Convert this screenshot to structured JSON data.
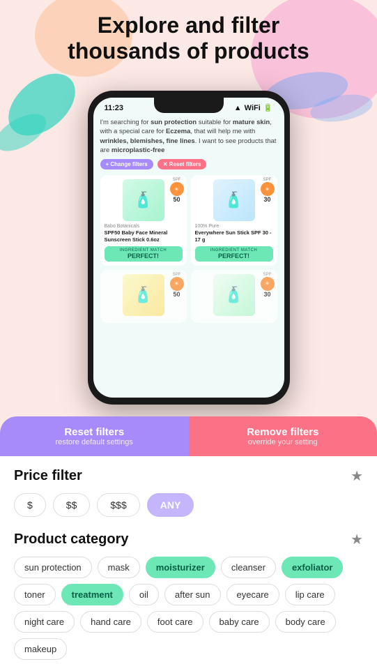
{
  "hero": {
    "title_line1": "Explore and filter",
    "title_line2": "thousands of products"
  },
  "phone": {
    "status_time": "11:23",
    "search_text_html": "I'm searching for <strong>sun protection</strong> suitable for <strong>mature skin</strong>, with a special care for <strong>Eczema</strong>, that will help me with <strong>wrinkles, blemishes, fine lines</strong>. I want to see products that are <strong>microplastic-free</strong>",
    "btn_change_filters": "+ Change filters",
    "btn_reset_filters_top": "✕ Reset filters",
    "products": [
      {
        "brand": "Babo Botanicals",
        "name": "SPF50 Baby Face Mineral Sunscreen Stick 0.6oz",
        "spf_label": "SPF",
        "spf_value": "50",
        "match_label": "INGREDIENT MATCH",
        "match_value": "PERFECT!"
      },
      {
        "brand": "100% Pure",
        "name": "Everywhere Sun Stick SPF 30 - 17 g",
        "spf_label": "SPF",
        "spf_value": "30",
        "match_label": "INGREDIENT MATCH",
        "match_value": "PERFECT!"
      }
    ]
  },
  "bottom_panel": {
    "btn_reset_label": "Reset filters",
    "btn_reset_sub": "restore default settings",
    "btn_remove_label": "Remove filters",
    "btn_remove_sub": "override your setting",
    "price_filter": {
      "title": "Price filter",
      "options": [
        {
          "label": "$",
          "active": false
        },
        {
          "label": "$$",
          "active": false
        },
        {
          "label": "$$$",
          "active": false
        },
        {
          "label": "ANY",
          "active": true
        }
      ]
    },
    "product_category": {
      "title": "Product category",
      "tags": [
        {
          "label": "sun protection",
          "active": false
        },
        {
          "label": "mask",
          "active": false
        },
        {
          "label": "moisturizer",
          "active": true
        },
        {
          "label": "cleanser",
          "active": false
        },
        {
          "label": "exfoliator",
          "active": true
        },
        {
          "label": "toner",
          "active": false
        },
        {
          "label": "treatment",
          "active": true
        },
        {
          "label": "oil",
          "active": false
        },
        {
          "label": "after sun",
          "active": false
        },
        {
          "label": "eyecare",
          "active": false
        },
        {
          "label": "lip care",
          "active": false
        },
        {
          "label": "night care",
          "active": false
        },
        {
          "label": "hand care",
          "active": false
        },
        {
          "label": "foot care",
          "active": false
        },
        {
          "label": "baby care",
          "active": false
        },
        {
          "label": "body care",
          "active": false
        },
        {
          "label": "makeup",
          "active": false
        }
      ]
    }
  }
}
